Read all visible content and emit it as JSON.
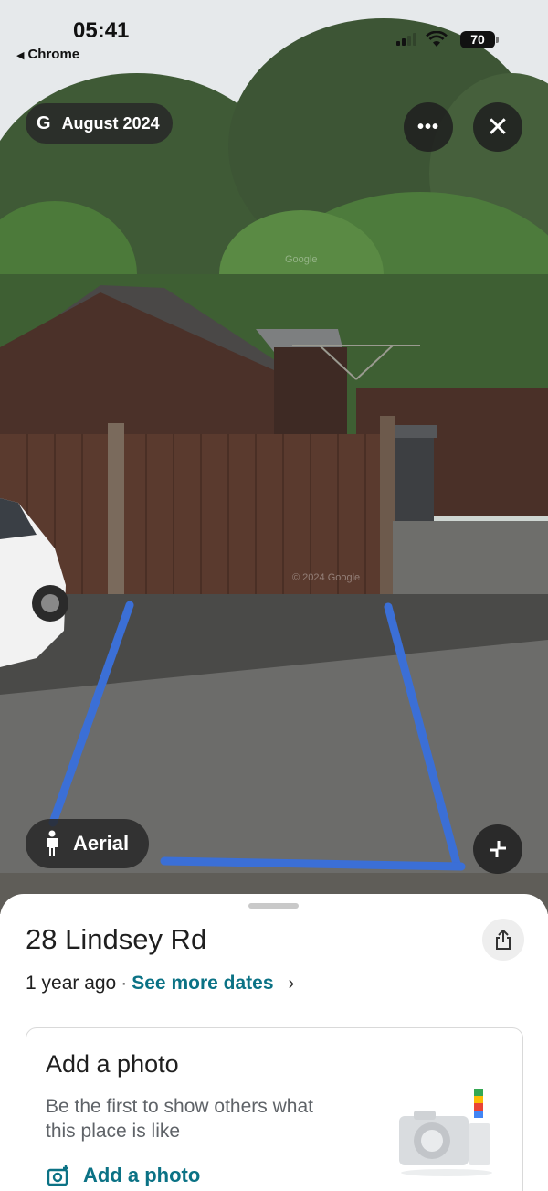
{
  "status_bar": {
    "time": "05:41",
    "back_app": "Chrome",
    "battery": "70"
  },
  "viewer": {
    "date_chip": "August 2024",
    "google_mark": "G",
    "more_icon": "more-horiz-icon",
    "close_icon": "close-icon",
    "aerial_label": "Aerial",
    "watermarks": [
      "Google",
      "© 2024 Google"
    ]
  },
  "place": {
    "title": "28 Lindsey Rd",
    "age": "1 year ago",
    "separator": "·",
    "see_dates": "See more dates"
  },
  "photo_card": {
    "title": "Add a photo",
    "description": "Be the first to show others what this place is like",
    "action": "Add a photo"
  },
  "colors": {
    "accent": "#0b7285",
    "chip_bg": "#282828",
    "parking_line": "#3b6fd6"
  }
}
